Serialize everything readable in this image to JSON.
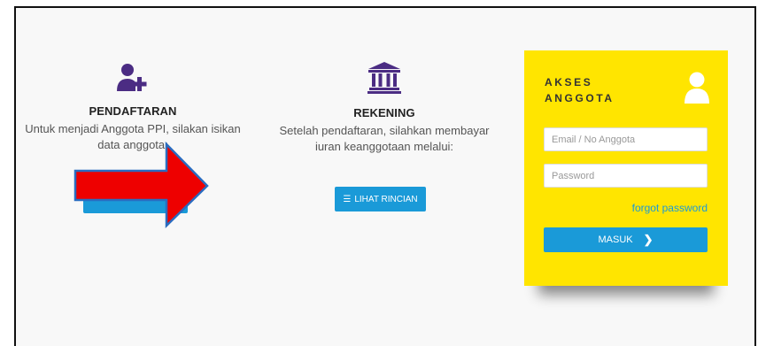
{
  "colors": {
    "accent_blue": "#1a9ad8",
    "icon_purple": "#4b2c83",
    "card_yellow": "#ffe500",
    "arrow_red": "#ee0000",
    "arrow_outline": "#2a6cc0"
  },
  "left_panel": {
    "icon": "user-plus-icon",
    "title": "PENDAFTARAN",
    "description": "Untuk menjadi Anggota PPI, silakan isikan data anggota:"
  },
  "middle_panel": {
    "icon": "bank-icon",
    "title": "REKENING",
    "description": "Setelah pendaftaran, silahkan membayar iuran keanggotaan melalui:",
    "button_icon": "list-icon",
    "button_label": "LIHAT RINCIAN"
  },
  "annotation": {
    "shape": "red-arrow",
    "direction": "right"
  },
  "login": {
    "title": "AKSES\nANGGOTA",
    "icon": "user-icon",
    "email_placeholder": "Email / No Anggota",
    "password_placeholder": "Password",
    "forgot_label": "forgot password",
    "submit_label": "MASUK",
    "submit_icon": "chevron-right-icon"
  }
}
